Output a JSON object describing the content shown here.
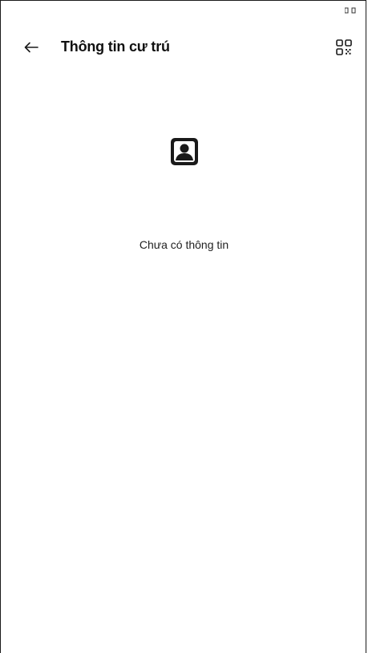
{
  "header": {
    "title": "Thông tin cư trú",
    "back_icon": "arrow-left-icon",
    "qr_icon": "qr-code-icon"
  },
  "empty_state": {
    "icon": "person-profile-icon",
    "message": "Chưa có thông tin"
  },
  "colors": {
    "background": "#ffffff",
    "text": "#111111",
    "icon": "#1a1a1a"
  }
}
